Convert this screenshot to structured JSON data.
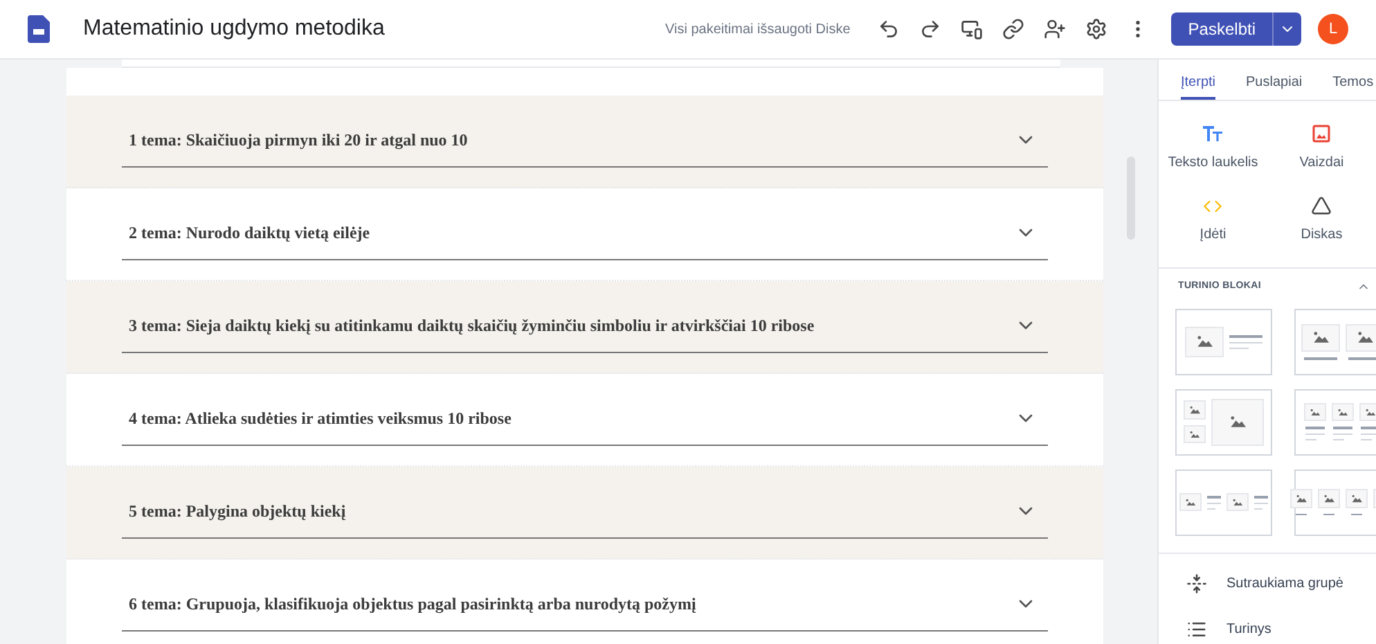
{
  "header": {
    "title": "Matematinio ugdymo metodika",
    "save_status": "Visi pakeitimai išsaugoti Diske",
    "publish": "Paskelbti",
    "avatar": "L"
  },
  "sections": [
    {
      "title": "1 tema: Skaičiuoja pirmyn iki 20 ir atgal nuo 10",
      "shaded": true
    },
    {
      "title": "2 tema: Nurodo daiktų vietą eilėje",
      "shaded": false
    },
    {
      "title": "3 tema: Sieja daiktų kiekį su atitinkamu daiktų skaičių žyminčiu simboliu ir atvirkščiai 10 ribose",
      "shaded": true
    },
    {
      "title": "4 tema: Atlieka sudėties ir atimties veiksmus 10 ribose",
      "shaded": false
    },
    {
      "title": "5 tema: Palygina objektų kiekį",
      "shaded": true
    },
    {
      "title": "6 tema: Grupuoja, klasifikuoja objektus pagal pasirinktą arba nurodytą požymį",
      "shaded": false
    }
  ],
  "panel": {
    "tabs": [
      {
        "label": "Įterpti",
        "selected": true
      },
      {
        "label": "Puslapiai",
        "selected": false
      },
      {
        "label": "Temos",
        "selected": false
      }
    ],
    "insert": [
      {
        "label": "Teksto laukelis",
        "kind": "text"
      },
      {
        "label": "Vaizdai",
        "kind": "image"
      },
      {
        "label": "Įdėti",
        "kind": "embed"
      },
      {
        "label": "Diskas",
        "kind": "drive"
      }
    ],
    "blocks_heading": "TURINIO BLOKAI",
    "items": [
      {
        "label": "Sutraukiama grupė",
        "kind": "collapsible"
      },
      {
        "label": "Turinys",
        "kind": "toc"
      }
    ]
  }
}
